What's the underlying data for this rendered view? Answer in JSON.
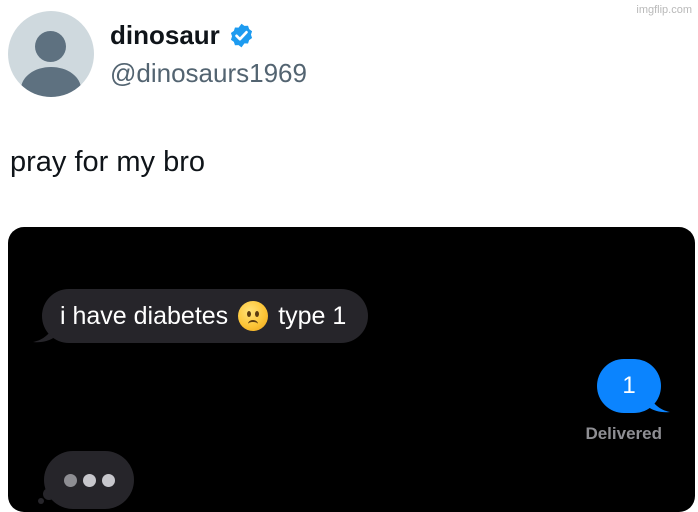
{
  "watermark": "imgflip.com",
  "tweet": {
    "display_name": "dinosaur",
    "handle": "@dinosaurs1969",
    "text": "pray for my bro",
    "verified": true
  },
  "chat": {
    "incoming_message": {
      "text_before_emoji": "i have diabetes",
      "emoji": "slightly-frowning-face",
      "text_after_emoji": "type 1"
    },
    "outgoing_message": "1",
    "status": "Delivered",
    "typing_indicator": true
  },
  "colors": {
    "verified": "#1d9bf0",
    "incoming_bubble": "#26252a",
    "outgoing_bubble": "#0b84fe",
    "chat_background": "#000000"
  }
}
